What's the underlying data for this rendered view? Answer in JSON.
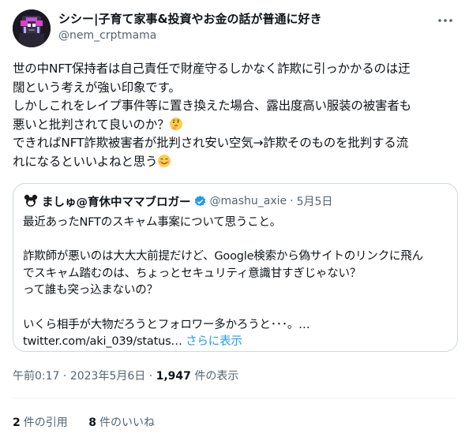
{
  "author": {
    "display_name": "シシー|子育て家事&投資やお金の話が普通に好き",
    "handle": "@nem_crptmama"
  },
  "tweet": {
    "line1": "世の中NFT保持者は自己責任で財産守るしかなく詐欺に引っかかるのは迂",
    "line2": "闊という考えが強い印象です。",
    "line3": "しかしこれをレイプ事件等に置き換えた場合、露出度高い服装の被害者も",
    "line4": "悪いと批判されて良いのか？",
    "line5": "できればNFT詐欺被害者が批判され安い空気→詐欺そのものを批判する流",
    "line6": "れになるといいよねと思う"
  },
  "quoted": {
    "display_name": "ましゅ@育休中ママブロガー",
    "handle": "@mashu_axie",
    "separator": "·",
    "date": "5月5日",
    "line1": "最近あったNFTのスキャム事案について思うこと。",
    "line2": "詐欺師が悪いのは大大大前提だけど、Google検索から偽サイトのリンクに飛ん",
    "line3": "でスキャム踏むのは、ちょっとセキュリティ意識甘すぎじゃない？",
    "line4": "って誰も突っ込まないの？",
    "line5": "いくら相手が大物だろうとフォロワー多かろうと･･･。…",
    "link": "twitter.com/aki_039/status…",
    "show_more": "さらに表示"
  },
  "meta": {
    "time": "午前0:17",
    "separator": "·",
    "date": "2023年5月6日",
    "views_count": "1,947",
    "views_label": "件の表示"
  },
  "stats": {
    "quotes_count": "2",
    "quotes_label": "件の引用",
    "likes_count": "8",
    "likes_label": "件のいいね"
  },
  "icons": {
    "more": "more-dots-icon",
    "verified": "verified-badge-icon",
    "thinking": "thinking-face-emoji",
    "smile": "smiling-face-emoji"
  },
  "colors": {
    "text": "#0f1419",
    "secondary": "#536471",
    "link": "#1d9bf0",
    "border": "#cfd9de",
    "avatar_accent": "#e040d0"
  }
}
